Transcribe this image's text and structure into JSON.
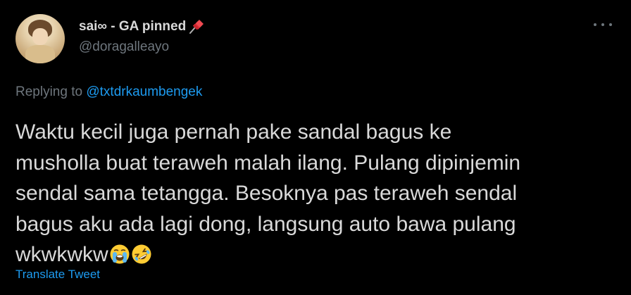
{
  "user": {
    "display_name": "sai∞ - GA pinned",
    "handle": "@doragalleayo",
    "badge_icon": "pushpin-icon"
  },
  "reply": {
    "prefix": "Replying to",
    "mention": "@txtdrkaumbengek"
  },
  "tweet": {
    "lines": [
      "Waktu kecil juga pernah pake sandal bagus ke",
      "musholla buat teraweh malah ilang. Pulang dipinjemin",
      "sendal sama tetangga. Besoknya pas teraweh sendal",
      "bagus aku ada lagi dong, langsung auto bawa pulang",
      "wkwkwkw"
    ],
    "emojis": [
      "loudly-crying-face-icon",
      "rolling-on-floor-laughing-icon"
    ]
  },
  "actions": {
    "translate": "Translate Tweet",
    "more_icon": "more-options-icon"
  },
  "colors": {
    "background": "#000000",
    "text": "#d9d9d9",
    "muted": "#6e767d",
    "link": "#1d9bf0"
  }
}
